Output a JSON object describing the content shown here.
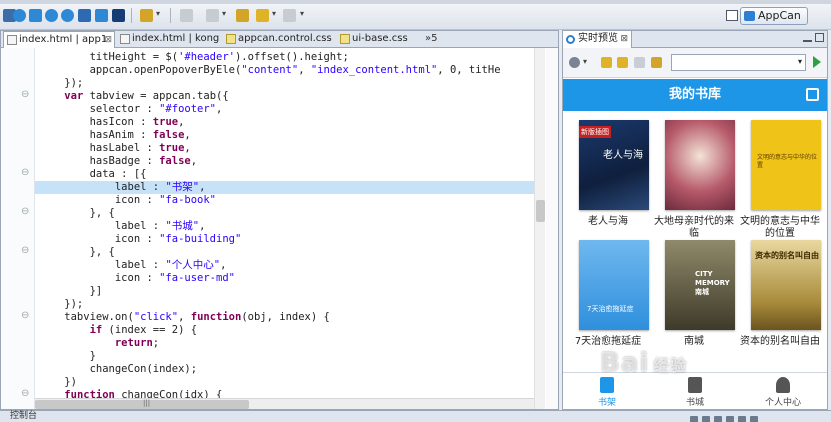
{
  "toolbar": {
    "perspective_label": "AppCan",
    "icons": [
      "save-icon",
      "refresh-icon",
      "build-icon",
      "power-icon",
      "view-icon",
      "database-icon",
      "panel-icon",
      "wand-icon",
      "new-file-icon",
      "copy-icon",
      "back-icon",
      "forward-icon"
    ]
  },
  "editor": {
    "tabs": [
      {
        "label": "index.html | app1",
        "active": true
      },
      {
        "label": "index.html | kong",
        "active": false
      },
      {
        "label": "appcan.control.css",
        "active": false
      },
      {
        "label": "ui-base.css",
        "active": false
      }
    ],
    "tab_overflow": "»5",
    "lines": [
      "        titHeight = $('#header').offset().height;",
      "        appcan.openPopoverByEle(\"content\", \"index_content.html\", 0, titHe",
      "    });",
      "    var tabview = appcan.tab({",
      "        selector : \"#footer\",",
      "        hasIcon : true,",
      "        hasAnim : false,",
      "        hasLabel : true,",
      "        hasBadge : false,",
      "        data : [{",
      "            label : \"书架\",",
      "            icon : \"fa-book\"",
      "        }, {",
      "            label : \"书城\",",
      "            icon : \"fa-building\"",
      "        }, {",
      "            label : \"个人中心\",",
      "            icon : \"fa-user-md\"",
      "        }]",
      "    });",
      "    tabview.on(\"click\", function(obj, index) {",
      "        if (index == 2) {",
      "            return;",
      "        }",
      "        changeCon(index);",
      "    })",
      "    function changeCon(idx) {"
    ],
    "highlighted_line": 10
  },
  "preview": {
    "tab_label": "实时预览",
    "select_value": "",
    "header_title": "我的书库",
    "books": [
      {
        "title": "老人与海",
        "cover_text": "老人与海",
        "badge": "新版插图"
      },
      {
        "title": "大地母亲时代的来临",
        "cover_text": "",
        "badge": ""
      },
      {
        "title": "文明的意志与中华的位置",
        "cover_text": "文明的意志与中华的位置",
        "badge": ""
      },
      {
        "title": "7天治愈拖延症",
        "cover_text": "7天治愈拖延症",
        "badge": ""
      },
      {
        "title": "南城",
        "cover_text": "CITY MEMORY 南城",
        "badge": ""
      },
      {
        "title": "资本的别名叫自由",
        "cover_text": "资本的别名叫自由",
        "badge": ""
      }
    ],
    "footer_tabs": [
      {
        "label": "书架",
        "active": true
      },
      {
        "label": "书城",
        "active": false
      },
      {
        "label": "个人中心",
        "active": false
      }
    ]
  },
  "bottom": {
    "console_tab": "控制台"
  },
  "watermark": {
    "text": "Bai",
    "suffix": "经验"
  },
  "colors": {
    "accent": "#1e96e8",
    "highlight_line": "#c6e2f8",
    "keyword": "#7f0055",
    "string": "#2a00ff"
  }
}
